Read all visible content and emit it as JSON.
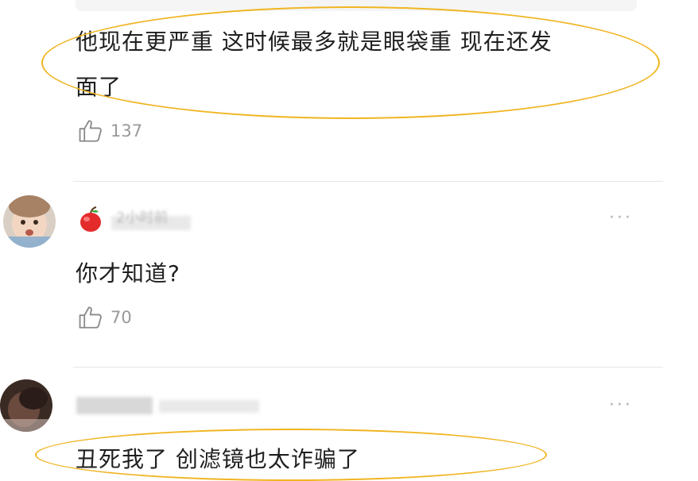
{
  "comments": [
    {
      "text_line1": "他现在更严重 这时候最多就是眼袋重 现在还发",
      "text_line2": "面了",
      "likes": "137"
    },
    {
      "meta": "2小时前",
      "text": "你才知道?",
      "likes": "70",
      "more": "···"
    },
    {
      "text": "丑死我了 创滤镜也太诈骗了",
      "more": "···"
    }
  ],
  "colors": {
    "highlight_ellipse": "#f0b522",
    "divider": "#e6e6e6",
    "meta": "#999999"
  },
  "icons": [
    "thumbs-up-icon",
    "apple-icon",
    "more-icon",
    "avatar"
  ]
}
